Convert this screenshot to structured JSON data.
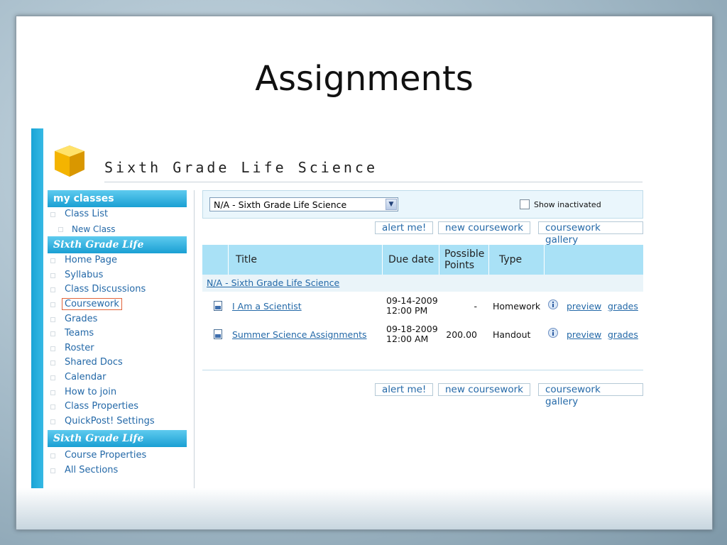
{
  "slide": {
    "title": "Assignments"
  },
  "app": {
    "course_title": "Sixth Grade Life Science"
  },
  "sidebar": {
    "my_classes_header": "my classes",
    "my_classes_items": [
      {
        "label": "Class List",
        "sub": false
      },
      {
        "label": "New Class",
        "sub": true
      }
    ],
    "course_header": "Sixth Grade Life Science",
    "course_items": [
      {
        "label": "Home Page"
      },
      {
        "label": "Syllabus"
      },
      {
        "label": "Class Discussions"
      },
      {
        "label": "Coursework",
        "active": true
      },
      {
        "label": "Grades"
      },
      {
        "label": "Teams"
      },
      {
        "label": "Roster"
      },
      {
        "label": "Shared Docs"
      },
      {
        "label": "Calendar"
      },
      {
        "label": "How to join"
      },
      {
        "label": "Class Properties"
      },
      {
        "label": "QuickPost! Settings"
      }
    ],
    "section_header": "Sixth Grade Life Science",
    "section_items": [
      {
        "label": "Course Properties"
      },
      {
        "label": "All Sections"
      }
    ]
  },
  "filter": {
    "select_value": "N/A - Sixth Grade Life Science",
    "show_inactivated_label": "Show inactivated",
    "show_inactivated_checked": false
  },
  "buttons": {
    "alert": "alert me!",
    "new_coursework": "new coursework",
    "gallery": "coursework gallery"
  },
  "table": {
    "headers": {
      "title": "Title",
      "due_date": "Due date",
      "possible_points": "Possible Points",
      "type": "Type"
    },
    "group_label": "N/A - Sixth Grade Life Science",
    "rows": [
      {
        "title": "I Am a Scientist",
        "due": "09-14-2009\n12:00 PM",
        "points": "-",
        "type": "Homework",
        "preview": "preview",
        "grades": "grades"
      },
      {
        "title": "Summer Science Assignments",
        "due": "09-18-2009\n12:00 AM",
        "points": "200.00",
        "type": "Handout",
        "preview": "preview",
        "grades": "grades"
      }
    ]
  },
  "colors": {
    "accent": "#1aa4d6",
    "link": "#2469a8",
    "header_bg": "#a9e1f6",
    "active_outline": "#e0643a"
  },
  "icons": {
    "logo": "yellow-cube-logo",
    "assignment": "document-icon",
    "info": "info-icon"
  }
}
